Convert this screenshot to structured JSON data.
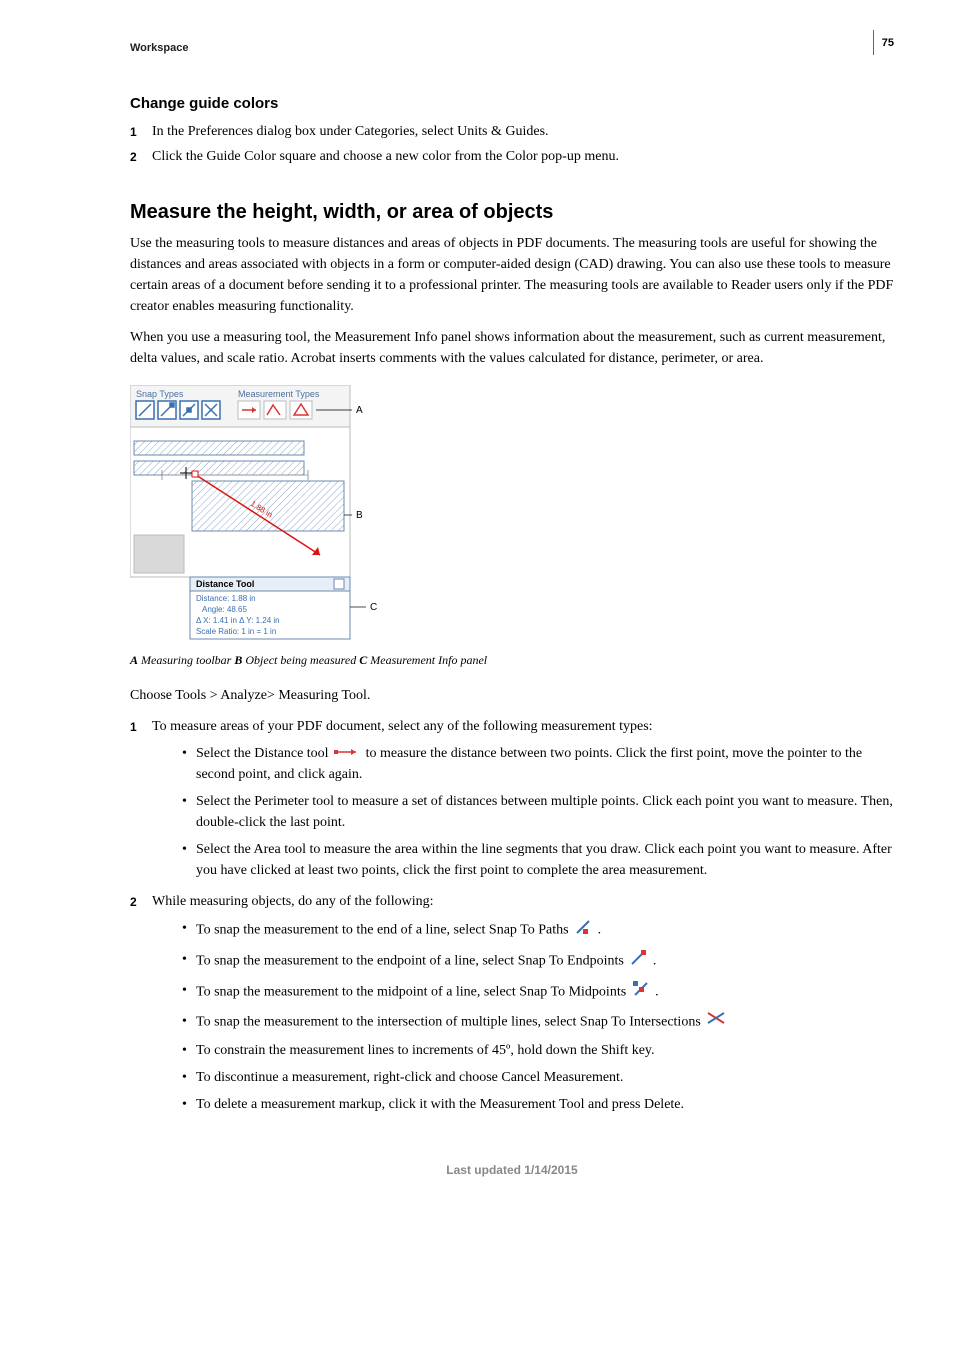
{
  "page": {
    "breadcrumb": "Workspace",
    "number": "75",
    "footer": "Last updated 1/14/2015"
  },
  "sub1": {
    "title": "Change guide colors",
    "steps": [
      "In the Preferences dialog box under Categories, select Units & Guides.",
      "Click the Guide Color square and choose a new color from the Color pop-up menu."
    ]
  },
  "section2": {
    "title": "Measure the height, width, or area of objects",
    "para1": "Use the measuring tools to measure distances and areas of objects in PDF documents. The measuring tools are useful for showing the distances and areas associated with objects in a form or computer-aided design (CAD) drawing. You can also use these tools to measure certain areas of a document before sending it to a professional printer. The measuring tools are available to Reader users only if the PDF creator enables measuring functionality.",
    "para2": "When you use a measuring tool, the Measurement Info panel shows information about the measurement, such as current measurement, delta values, and scale ratio. Acrobat inserts comments with the values calculated for distance, perimeter, or area.",
    "figure": {
      "snap_types_label": "Snap Types",
      "measurement_types_label": "Measurement Types",
      "panel_title": "Distance Tool",
      "panel_lines": [
        "Distance: 1.88 in",
        "Angle: 48.65",
        "Δ X: 1.41 in    Δ Y: 1.24 in",
        "Scale Ratio: 1 in = 1 in"
      ],
      "dimension_label": "1.88 in",
      "markers": {
        "a": "A",
        "b": "B",
        "c": "C"
      }
    },
    "caption_parts": [
      "A",
      " Measuring toolbar  ",
      "B",
      " Object being measured  ",
      "C",
      " Measurement Info panel"
    ],
    "para3": "Choose Tools > Analyze> Measuring Tool.",
    "step1": {
      "intro": "To measure areas of your PDF document, select any of the following measurement types:",
      "bullets": {
        "b1a": "Select the Distance tool ",
        "b1b": " to measure the distance between two points. Click the first point, move the pointer to the second point, and click again.",
        "b2": "Select the Perimeter tool to measure a set of distances between multiple points. Click each point you want to measure. Then, double-click the last point.",
        "b3": "Select the Area tool to measure the area within the line segments that you draw. Click each point you want to measure. After you have clicked at least two points, click the first point to complete the area measurement."
      }
    },
    "step2": {
      "intro": "While measuring objects, do any of the following:",
      "bullets": {
        "b1a": "To snap the measurement to the end of a line, select Snap To Paths ",
        "b1b": " .",
        "b2a": "To snap the measurement to the endpoint of a line, select Snap To Endpoints ",
        "b2b": " .",
        "b3a": "To snap the measurement to the midpoint of a line, select Snap To Midpoints ",
        "b3b": " .",
        "b4": "To snap the measurement to the intersection of multiple lines, select Snap To Intersections ",
        "b5": "To constrain the measurement lines to increments of 45º, hold down the Shift key.",
        "b6": "To discontinue a measurement, right-click and choose Cancel Measurement.",
        "b7": "To delete a measurement markup, click it with the Measurement Tool and press Delete."
      }
    }
  }
}
